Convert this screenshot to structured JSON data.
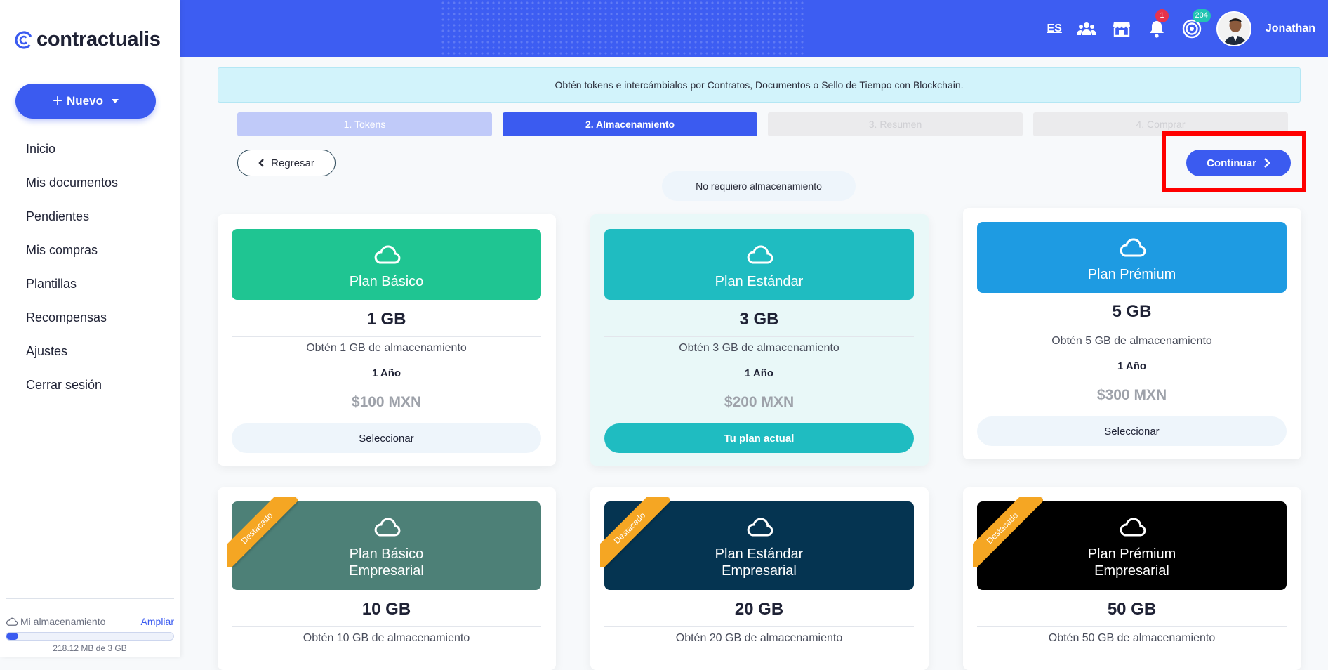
{
  "brand": {
    "name": "contractualis",
    "accent": "#3b5bf0"
  },
  "sidebar": {
    "new_button": "Nuevo",
    "items": [
      {
        "label": "Inicio"
      },
      {
        "label": "Mis documentos"
      },
      {
        "label": "Pendientes"
      },
      {
        "label": "Mis compras"
      },
      {
        "label": "Plantillas"
      },
      {
        "label": "Recompensas"
      },
      {
        "label": "Ajustes"
      },
      {
        "label": "Cerrar sesión"
      }
    ],
    "storage": {
      "label": "Mi almacenamiento",
      "expand_link": "Ampliar",
      "used_text": "218.12 MB de 3 GB",
      "used_fraction": 0.07
    }
  },
  "topbar": {
    "language": "ES",
    "notifications_count": "1",
    "tokens_count": "204",
    "username": "Jonathan",
    "icons": [
      "users-icon",
      "store-icon",
      "bell-icon",
      "token-icon"
    ]
  },
  "notice": "Obtén tokens e intercámbialos por Contratos, Documentos o Sello de Tiempo con Blockchain.",
  "steps": [
    {
      "label": "1. Tokens",
      "state": "done"
    },
    {
      "label": "2. Almacenamiento",
      "state": "active"
    },
    {
      "label": "3. Resumen",
      "state": "todo"
    },
    {
      "label": "4. Comprar",
      "state": "todo"
    }
  ],
  "actions": {
    "back": "Regresar",
    "no_storage": "No requiero almacenamiento",
    "continue": "Continuar"
  },
  "plans": [
    {
      "name": "Plan Básico",
      "gb": "1 GB",
      "desc": "Obtén 1 GB de almacenamiento",
      "term": "1 Año",
      "price": "$100 MXN",
      "button": "Seleccionar",
      "color": "#1fc592",
      "current": false
    },
    {
      "name": "Plan Estándar",
      "gb": "3 GB",
      "desc": "Obtén 3 GB de almacenamiento",
      "term": "1 Año",
      "price": "$200 MXN",
      "button": "Tu plan actual",
      "color": "#1fbcc1",
      "current": true
    },
    {
      "name": "Plan Prémium",
      "gb": "5 GB",
      "desc": "Obtén 5 GB de almacenamiento",
      "term": "1 Año",
      "price": "$300 MXN",
      "button": "Seleccionar",
      "color": "#1e9be2",
      "current": false
    },
    {
      "name": "Plan Básico Empresarial",
      "name_line1": "Plan Básico",
      "name_line2": "Empresarial",
      "gb": "10 GB",
      "desc": "Obtén 10 GB de almacenamiento",
      "ribbon": "Destacado",
      "color": "#4d8077"
    },
    {
      "name": "Plan Estándar Empresarial",
      "name_line1": "Plan Estándar",
      "name_line2": "Empresarial",
      "gb": "20 GB",
      "desc": "Obtén 20 GB de almacenamiento",
      "ribbon": "Destacado",
      "color": "#053451"
    },
    {
      "name": "Plan Prémium Empresarial",
      "name_line1": "Plan Prémium",
      "name_line2": "Empresarial",
      "gb": "50 GB",
      "desc": "Obtén 50 GB de almacenamiento",
      "ribbon": "Destacado",
      "color": "#000000"
    }
  ]
}
